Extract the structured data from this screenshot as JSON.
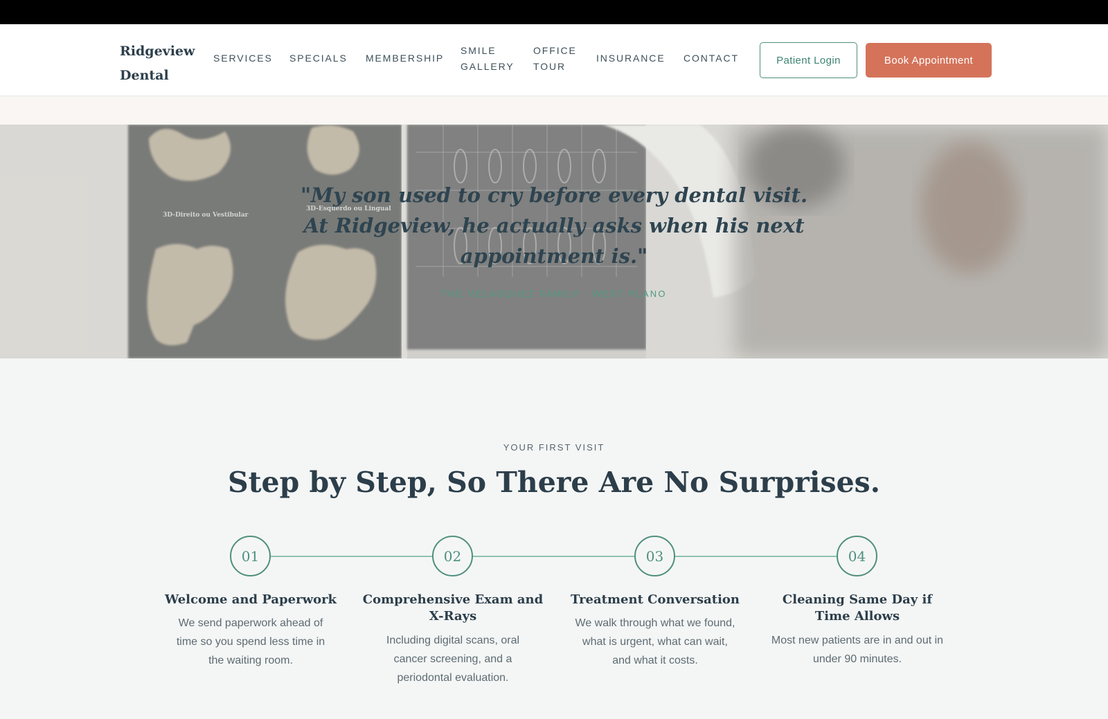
{
  "brand": {
    "name": "Ridgeview Dental"
  },
  "nav": {
    "items": [
      {
        "label": "SERVICES"
      },
      {
        "label": "SPECIALS"
      },
      {
        "label": "MEMBERSHIP"
      },
      {
        "label": "SMILE GALLERY"
      },
      {
        "label": "OFFICE TOUR"
      },
      {
        "label": "INSURANCE"
      },
      {
        "label": "CONTACT"
      }
    ],
    "login_label": "Patient Login",
    "book_label": "Book Appointment"
  },
  "testimonial": {
    "quote": "\"My son used to cry before every dental visit. At Ridgeview, he actually asks when his next appointment is.\"",
    "attribution": "THE VELASQUEZ FAMILY · WEST PLANO",
    "image_texts": [
      "3D-Direito ou Vestibular",
      "3D-Esquerdo ou Lingual"
    ]
  },
  "first_visit": {
    "eyebrow": "YOUR FIRST VISIT",
    "title": "Step by Step, So There Are No Surprises.",
    "steps": [
      {
        "number": "01",
        "title": "Welcome and Paperwork",
        "description": "We send paperwork ahead of time so you spend less time in the waiting room."
      },
      {
        "number": "02",
        "title": "Comprehensive Exam and X-Rays",
        "description": "Including digital scans, oral cancer screening, and a periodontal evaluation."
      },
      {
        "number": "03",
        "title": "Treatment Conversation",
        "description": "We walk through what we found, what is urgent, what can wait, and what it costs."
      },
      {
        "number": "04",
        "title": "Cleaning Same Day if Time Allows",
        "description": "Most new patients are in and out in under 90 minutes."
      }
    ]
  },
  "colors": {
    "accent_green": "#4f8f7d",
    "accent_coral": "#d4735a",
    "ink": "#2c3e4a"
  }
}
